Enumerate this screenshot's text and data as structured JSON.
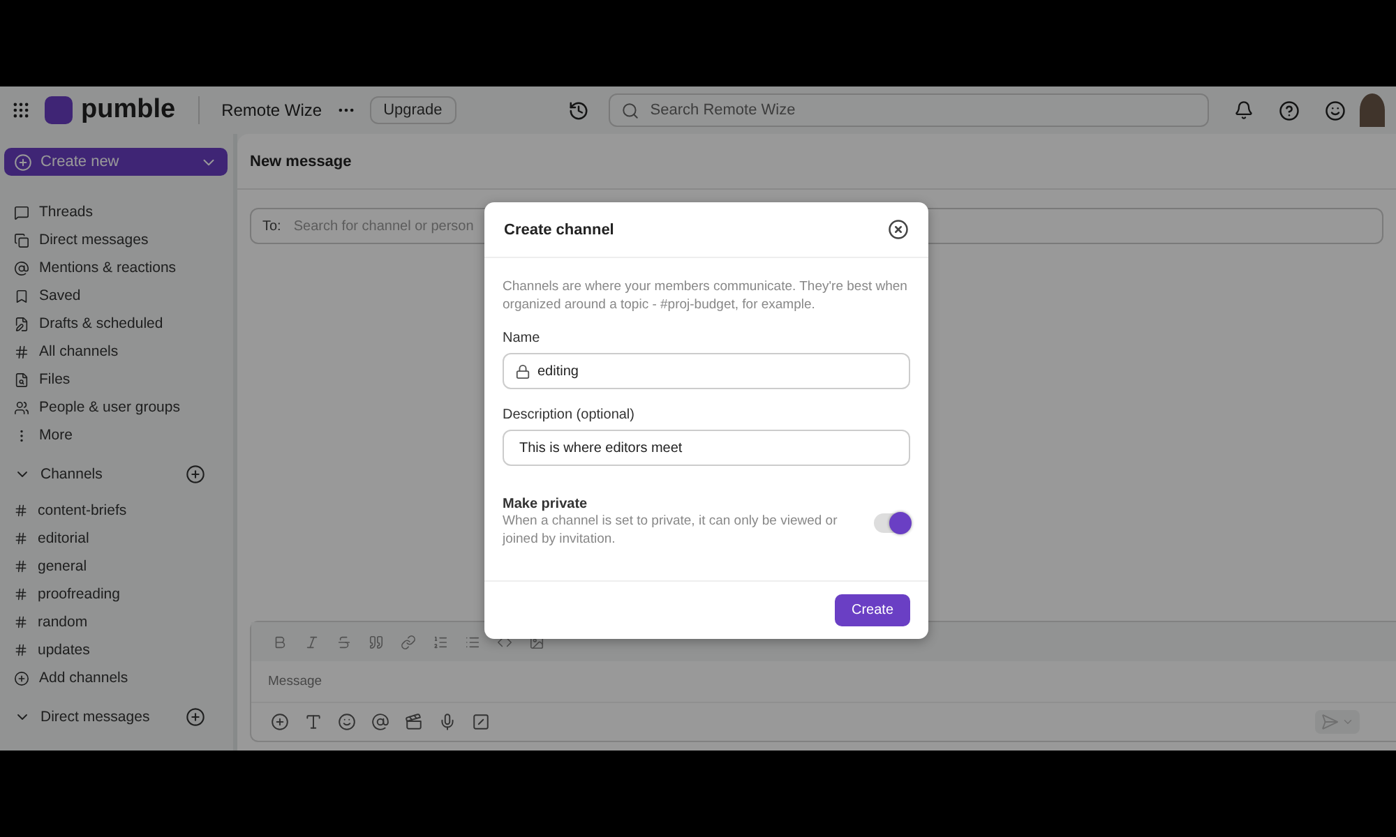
{
  "topbar": {
    "logo_text": "pumble",
    "workspace": "Remote Wize",
    "upgrade_button": "Upgrade",
    "search_placeholder": "Search Remote Wize"
  },
  "sidebar": {
    "create_button": "Create new",
    "nav_items": [
      {
        "kind": "threads",
        "label": "Threads"
      },
      {
        "kind": "dms",
        "label": "Direct messages"
      },
      {
        "kind": "mentions",
        "label": "Mentions & reactions"
      },
      {
        "kind": "saved",
        "label": "Saved"
      },
      {
        "kind": "drafts",
        "label": "Drafts & scheduled"
      },
      {
        "kind": "channels",
        "label": "All channels"
      },
      {
        "kind": "files",
        "label": "Files"
      },
      {
        "kind": "people",
        "label": "People & user groups"
      },
      {
        "kind": "more",
        "label": "More"
      }
    ],
    "sections": [
      {
        "title": "Channels",
        "expanded": true,
        "items": [
          "content-briefs",
          "editorial",
          "general",
          "proofreading",
          "random",
          "updates"
        ],
        "add_label": "Add channels"
      },
      {
        "title": "Direct messages",
        "expanded": true
      }
    ]
  },
  "main": {
    "title": "New message",
    "to_label": "To:",
    "to_placeholder": "Search for channel or person",
    "composer_placeholder": "Message"
  },
  "modal": {
    "title": "Create channel",
    "description": "Channels are where your members communicate. They're best when organized around a topic - #proj-budget, for example.",
    "name_label": "Name",
    "name_value": "editing",
    "description_label": "Description (optional)",
    "description_value": "This is where editors meet",
    "private_title": "Make private",
    "private_description": "When a channel is set to private, it can only be viewed or joined by invitation.",
    "private_on": true,
    "create_button": "Create"
  }
}
